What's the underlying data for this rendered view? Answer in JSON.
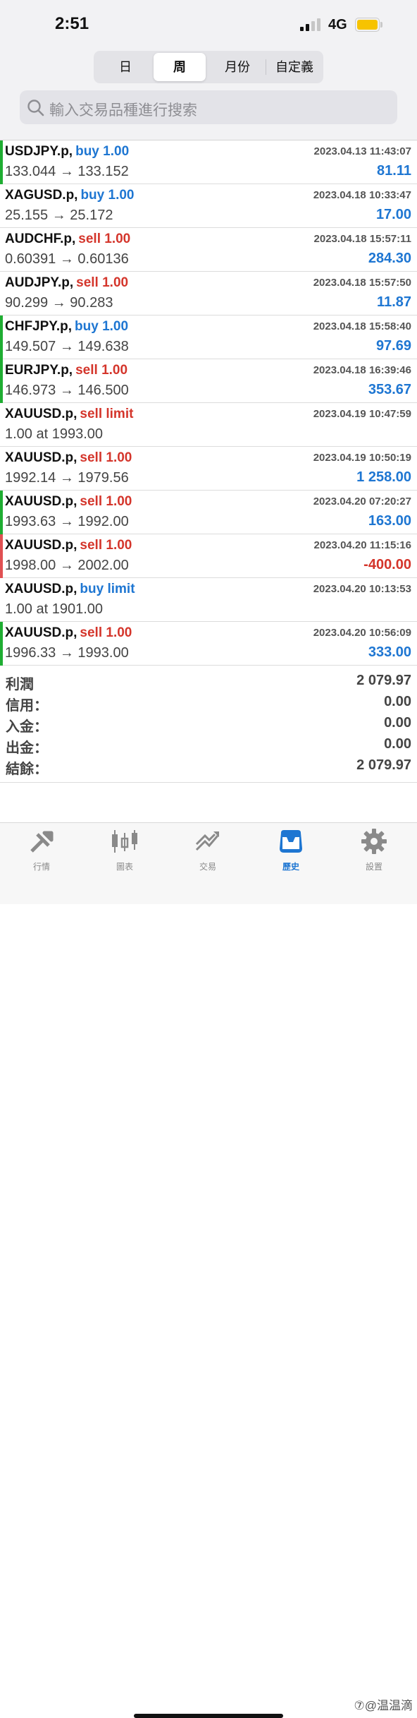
{
  "status": {
    "time": "2:51",
    "network": "4G"
  },
  "period_tabs": [
    {
      "label": "日",
      "active": false
    },
    {
      "label": "周",
      "active": true
    },
    {
      "label": "月份",
      "active": false
    },
    {
      "label": "自定義",
      "active": false
    }
  ],
  "search": {
    "placeholder": "輸入交易品種進行搜索"
  },
  "history": [
    {
      "symbol": "USDJPY.p,",
      "side": "buy 1.00",
      "side_type": "buy",
      "time": "2023.04.13 11:43:07",
      "prices": "133.044 → 133.152",
      "profit": "81.11",
      "profit_type": "pos",
      "bar": "green"
    },
    {
      "symbol": "XAGUSD.p,",
      "side": "buy 1.00",
      "side_type": "buy",
      "time": "2023.04.18 10:33:47",
      "prices": "25.155 → 25.172",
      "profit": "17.00",
      "profit_type": "pos",
      "bar": "none"
    },
    {
      "symbol": "AUDCHF.p,",
      "side": "sell 1.00",
      "side_type": "sell",
      "time": "2023.04.18 15:57:11",
      "prices": "0.60391 → 0.60136",
      "profit": "284.30",
      "profit_type": "pos",
      "bar": "none"
    },
    {
      "symbol": "AUDJPY.p,",
      "side": "sell 1.00",
      "side_type": "sell",
      "time": "2023.04.18 15:57:50",
      "prices": "90.299 → 90.283",
      "profit": "11.87",
      "profit_type": "pos",
      "bar": "none"
    },
    {
      "symbol": "CHFJPY.p,",
      "side": "buy 1.00",
      "side_type": "buy",
      "time": "2023.04.18 15:58:40",
      "prices": "149.507 → 149.638",
      "profit": "97.69",
      "profit_type": "pos",
      "bar": "green"
    },
    {
      "symbol": "EURJPY.p,",
      "side": "sell 1.00",
      "side_type": "sell",
      "time": "2023.04.18 16:39:46",
      "prices": "146.973 → 146.500",
      "profit": "353.67",
      "profit_type": "pos",
      "bar": "green"
    },
    {
      "symbol": "XAUUSD.p,",
      "side": "sell limit",
      "side_type": "sell",
      "time": "2023.04.19 10:47:59",
      "prices": "1.00 at 1993.00",
      "profit": "",
      "profit_type": "pos",
      "bar": "none"
    },
    {
      "symbol": "XAUUSD.p,",
      "side": "sell 1.00",
      "side_type": "sell",
      "time": "2023.04.19 10:50:19",
      "prices": "1992.14 → 1979.56",
      "profit": "1 258.00",
      "profit_type": "pos",
      "bar": "none"
    },
    {
      "symbol": "XAUUSD.p,",
      "side": "sell 1.00",
      "side_type": "sell",
      "time": "2023.04.20 07:20:27",
      "prices": "1993.63 → 1992.00",
      "profit": "163.00",
      "profit_type": "pos",
      "bar": "green"
    },
    {
      "symbol": "XAUUSD.p,",
      "side": "sell 1.00",
      "side_type": "sell",
      "time": "2023.04.20 11:15:16",
      "prices": "1998.00 → 2002.00",
      "profit": "-400.00",
      "profit_type": "neg",
      "bar": "red"
    },
    {
      "symbol": "XAUUSD.p,",
      "side": "buy limit",
      "side_type": "buy",
      "time": "2023.04.20 10:13:53",
      "prices": "1.00 at 1901.00",
      "profit": "",
      "profit_type": "pos",
      "bar": "none"
    },
    {
      "symbol": "XAUUSD.p,",
      "side": "sell 1.00",
      "side_type": "sell",
      "time": "2023.04.20 10:56:09",
      "prices": "1996.33 → 1993.00",
      "profit": "333.00",
      "profit_type": "pos",
      "bar": "green"
    }
  ],
  "summary": [
    {
      "label": "利潤",
      "value": "2 079.97"
    },
    {
      "label": "信用：",
      "value": "0.00"
    },
    {
      "label": "入金：",
      "value": "0.00"
    },
    {
      "label": "出金：",
      "value": "0.00"
    },
    {
      "label": "結餘：",
      "value": "2 079.97"
    }
  ],
  "tabbar": [
    {
      "label": "行情",
      "icon": "quotes-icon",
      "active": false
    },
    {
      "label": "圖表",
      "icon": "chart-icon",
      "active": false
    },
    {
      "label": "交易",
      "icon": "trade-icon",
      "active": false
    },
    {
      "label": "歷史",
      "icon": "history-icon",
      "active": true
    },
    {
      "label": "設置",
      "icon": "settings-gear-icon",
      "active": false
    }
  ],
  "watermark": "⑦@温温滴",
  "colors": {
    "buy": "#1e76d2",
    "sell": "#d4352b",
    "bar_green": "#1fad32",
    "bar_red": "#e05052",
    "active_tab": "#1e76d2"
  }
}
